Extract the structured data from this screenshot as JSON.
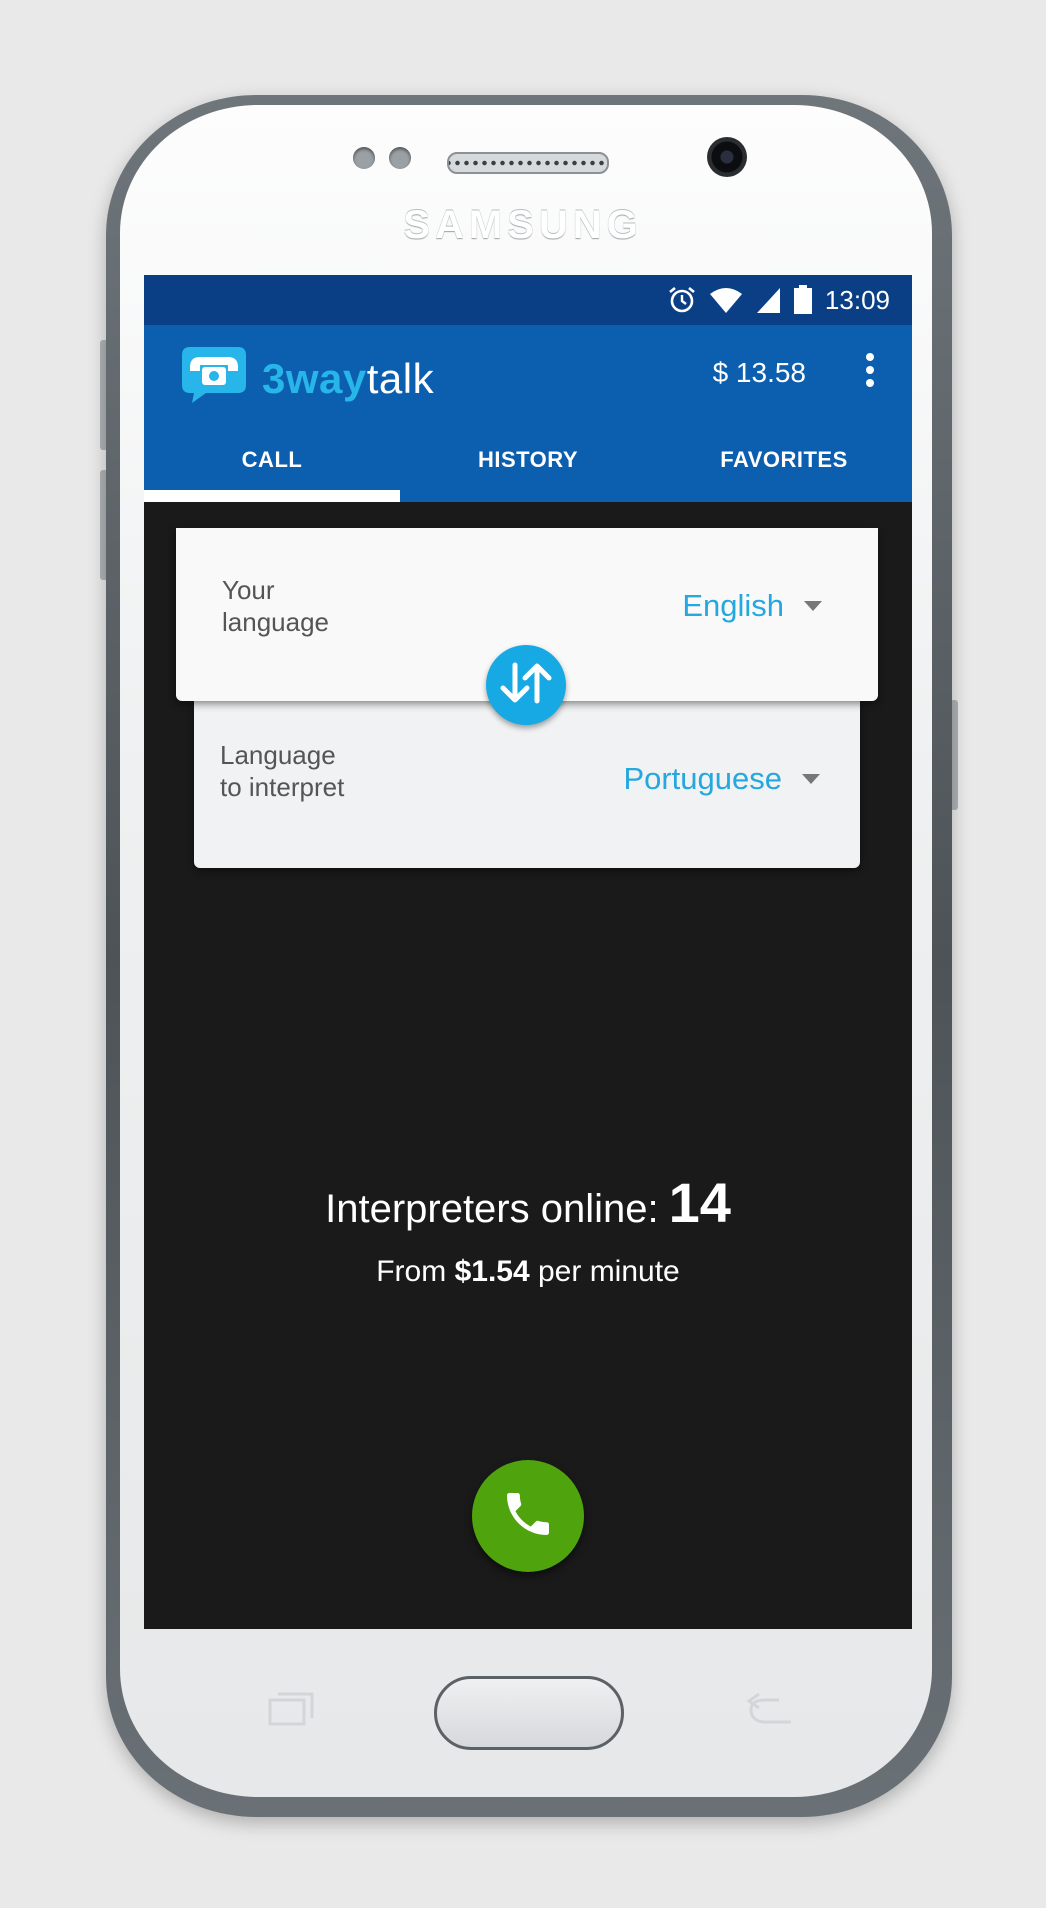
{
  "device": {
    "brand": "SAMSUNG"
  },
  "status_bar": {
    "time": "13:09",
    "icons": [
      "alarm-icon",
      "wifi-icon",
      "signal-icon",
      "battery-icon"
    ]
  },
  "app_bar": {
    "logo_part1": "3way",
    "logo_part2": "talk",
    "balance": "$ 13.58",
    "menu_icon": "more-vert-icon"
  },
  "tabs": [
    {
      "label": "CALL",
      "active": true
    },
    {
      "label": "HISTORY",
      "active": false
    },
    {
      "label": "FAVORITES",
      "active": false
    }
  ],
  "language_card": {
    "your_language_label_line1": "Your",
    "your_language_label_line2": "language",
    "your_language_value": "English",
    "interpret_label_line1": "Language",
    "interpret_label_line2": "to interpret",
    "interpret_value": "Portuguese"
  },
  "info": {
    "online_label": "Interpreters online:",
    "online_count": "14",
    "price_prefix": "From",
    "price_value": "$1.54",
    "price_suffix": "per minute"
  },
  "colors": {
    "status_bar": "#0a3f86",
    "app_bar": "#0b5fae",
    "accent": "#25a7df",
    "call_button": "#4fa30c",
    "screen_bg": "#1a1a1a"
  }
}
